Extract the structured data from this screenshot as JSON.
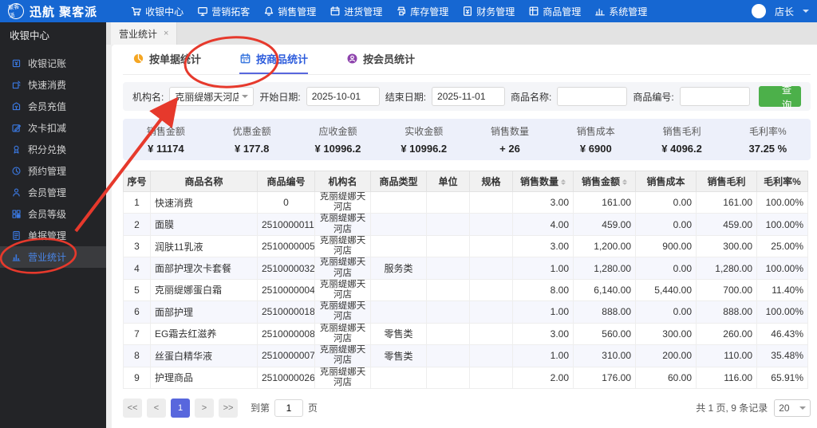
{
  "topbar": {
    "brand": "迅航 聚客派",
    "logo_text": "聚客派",
    "nav": [
      {
        "label": "收银中心",
        "icon": "cart"
      },
      {
        "label": "营销拓客",
        "icon": "monitor"
      },
      {
        "label": "销售管理",
        "icon": "bell"
      },
      {
        "label": "进货管理",
        "icon": "calendar"
      },
      {
        "label": "库存管理",
        "icon": "printer"
      },
      {
        "label": "财务管理",
        "icon": "finance"
      },
      {
        "label": "商品管理",
        "icon": "box"
      },
      {
        "label": "系统管理",
        "icon": "stats"
      }
    ],
    "actions": [
      "refresh",
      "expand",
      "apps",
      "shirt"
    ],
    "user": "店长"
  },
  "sidebar": {
    "title": "收银中心",
    "items": [
      {
        "label": "收银记账",
        "icon": "register",
        "active": false
      },
      {
        "label": "快速消费",
        "icon": "quick",
        "active": false
      },
      {
        "label": "会员充值",
        "icon": "wallet",
        "active": false
      },
      {
        "label": "次卡扣减",
        "icon": "edit",
        "active": false
      },
      {
        "label": "积分兑换",
        "icon": "medal",
        "active": false
      },
      {
        "label": "预约管理",
        "icon": "clock",
        "active": false
      },
      {
        "label": "会员管理",
        "icon": "person",
        "active": false
      },
      {
        "label": "会员等级",
        "icon": "grid88",
        "active": false
      },
      {
        "label": "单据管理",
        "icon": "doc",
        "active": false
      },
      {
        "label": "营业统计",
        "icon": "chartbars",
        "active": true
      }
    ]
  },
  "doc_tab": {
    "label": "营业统计",
    "close": "×"
  },
  "tabs": [
    {
      "label": "按单据统计",
      "icon": "pie",
      "color": "#f5a623",
      "active": false
    },
    {
      "label": "按商品统计",
      "icon": "calendar2",
      "color": "#3f7be0",
      "active": true
    },
    {
      "label": "按会员统计",
      "icon": "member",
      "color": "#8e44ad",
      "active": false
    }
  ],
  "filters": {
    "org_label": "机构名:",
    "org_value": "克丽缇娜天河店",
    "start_label": "开始日期:",
    "start_value": "2025-10-01",
    "end_label": "结束日期:",
    "end_value": "2025-11-01",
    "name_label": "商品名称:",
    "name_value": "",
    "code_label": "商品编号:",
    "code_value": "",
    "search_label": "查询"
  },
  "summary": [
    {
      "label": "销售金额",
      "value": "¥ 11174"
    },
    {
      "label": "优惠金额",
      "value": "¥ 177.8"
    },
    {
      "label": "应收金额",
      "value": "¥ 10996.2"
    },
    {
      "label": "实收金额",
      "value": "¥ 10996.2"
    },
    {
      "label": "销售数量",
      "value": "+ 26"
    },
    {
      "label": "销售成本",
      "value": "¥ 6900"
    },
    {
      "label": "销售毛利",
      "value": "¥ 4096.2"
    },
    {
      "label": "毛利率%",
      "value": "37.25 %"
    }
  ],
  "table": {
    "columns": [
      {
        "label": "序号",
        "sortable": false
      },
      {
        "label": "商品名称",
        "sortable": false
      },
      {
        "label": "商品编号",
        "sortable": false
      },
      {
        "label": "机构名",
        "sortable": false
      },
      {
        "label": "商品类型",
        "sortable": false
      },
      {
        "label": "单位",
        "sortable": false
      },
      {
        "label": "规格",
        "sortable": false
      },
      {
        "label": "销售数量",
        "sortable": true
      },
      {
        "label": "销售金额",
        "sortable": true
      },
      {
        "label": "销售成本",
        "sortable": false
      },
      {
        "label": "销售毛利",
        "sortable": false
      },
      {
        "label": "毛利率%",
        "sortable": false
      }
    ],
    "rows": [
      [
        "1",
        "快速消费",
        "0",
        "克丽缇娜天河店",
        "",
        "",
        "",
        "3.00",
        "161.00",
        "0.00",
        "161.00",
        "100.00%"
      ],
      [
        "2",
        "面膜",
        "2510000011",
        "克丽缇娜天河店",
        "",
        "",
        "",
        "4.00",
        "459.00",
        "0.00",
        "459.00",
        "100.00%"
      ],
      [
        "3",
        "润肤11乳液",
        "2510000005",
        "克丽缇娜天河店",
        "",
        "",
        "",
        "3.00",
        "1,200.00",
        "900.00",
        "300.00",
        "25.00%"
      ],
      [
        "4",
        "面部护理次卡套餐",
        "2510000032",
        "克丽缇娜天河店",
        "服务类",
        "",
        "",
        "1.00",
        "1,280.00",
        "0.00",
        "1,280.00",
        "100.00%"
      ],
      [
        "5",
        "克丽缇娜蛋白霜",
        "2510000004",
        "克丽缇娜天河店",
        "",
        "",
        "",
        "8.00",
        "6,140.00",
        "5,440.00",
        "700.00",
        "11.40%"
      ],
      [
        "6",
        "面部护理",
        "2510000018",
        "克丽缇娜天河店",
        "",
        "",
        "",
        "1.00",
        "888.00",
        "0.00",
        "888.00",
        "100.00%"
      ],
      [
        "7",
        "EG霜去红滋养",
        "2510000008",
        "克丽缇娜天河店",
        "零售类",
        "",
        "",
        "3.00",
        "560.00",
        "300.00",
        "260.00",
        "46.43%"
      ],
      [
        "8",
        "丝蛋白精华液",
        "2510000007",
        "克丽缇娜天河店",
        "零售类",
        "",
        "",
        "1.00",
        "310.00",
        "200.00",
        "110.00",
        "35.48%"
      ],
      [
        "9",
        "护理商品",
        "2510000026",
        "克丽缇娜天河店",
        "",
        "",
        "",
        "2.00",
        "176.00",
        "60.00",
        "116.00",
        "65.91%"
      ]
    ]
  },
  "pagination": {
    "first": "<<",
    "prev": "<",
    "page": "1",
    "next": ">",
    "last": ">>",
    "goto_prefix": "到第",
    "goto_value": "1",
    "goto_suffix": "页",
    "total_text": "共 1 页, 9 条记录",
    "page_size": "20"
  },
  "annotations": {
    "color": "#e6392c",
    "shapes": [
      "ellipse-around-tab-按商品统计",
      "ellipse-around-sidebar-营业统计",
      "arrow-from-sidebar-to-tab"
    ]
  }
}
